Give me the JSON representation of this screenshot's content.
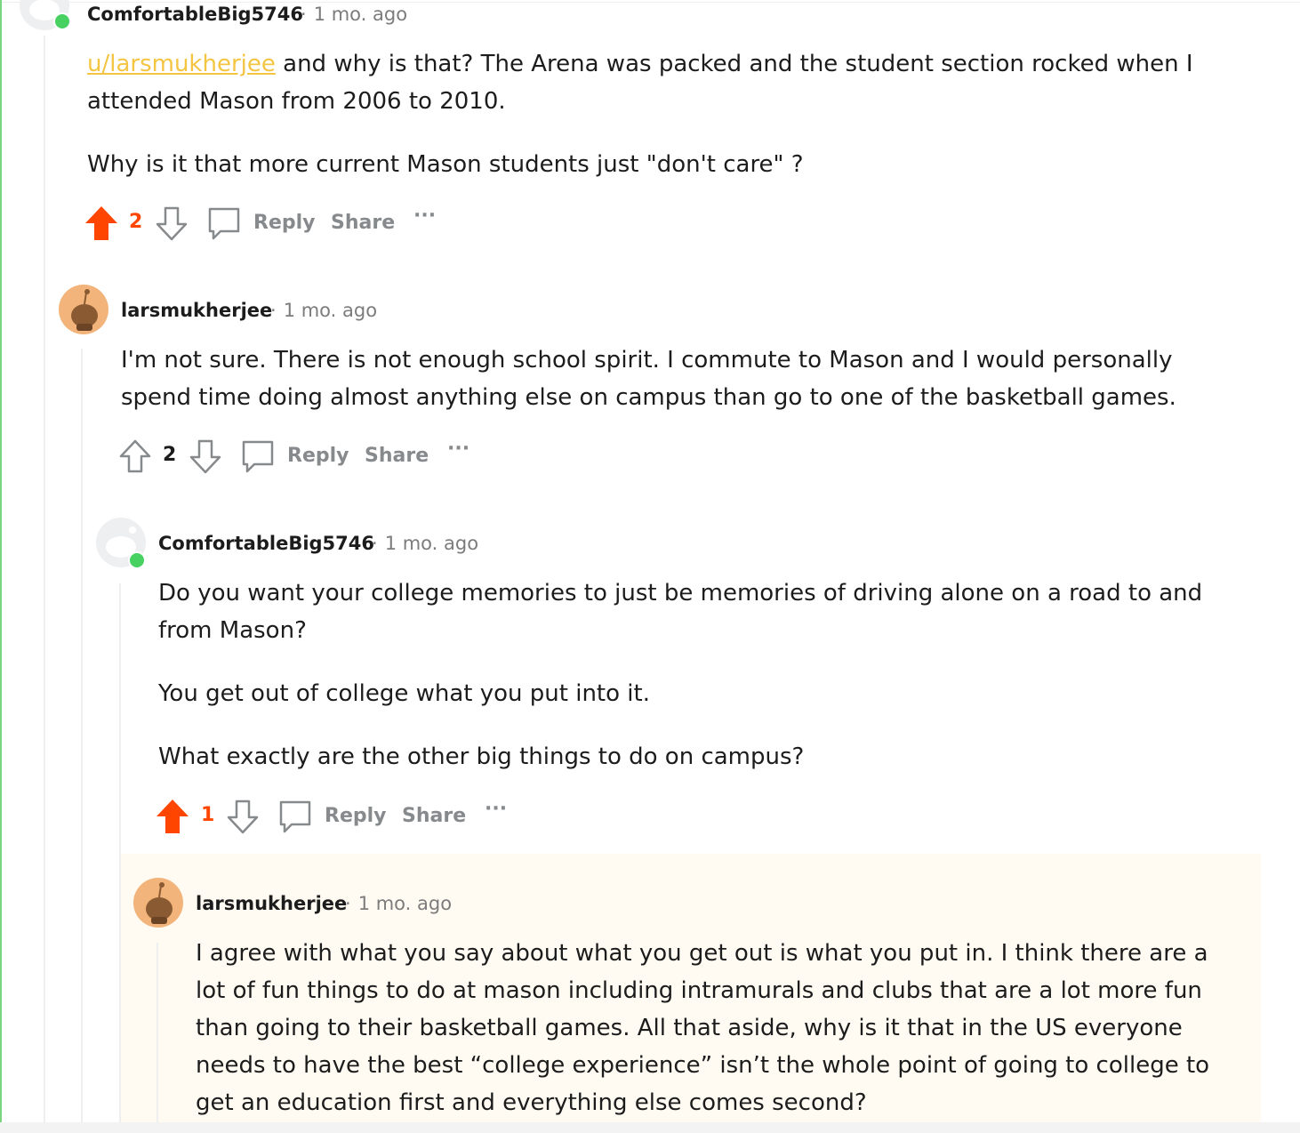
{
  "comments": [
    {
      "username": "ComfortableBig5746",
      "separator": "·",
      "time": "1 mo. ago",
      "mention": "u/larsmukherjee",
      "paragraphs": [
        " and why is that? The Arena was packed and the student section rocked when I attended Mason from 2006 to 2010.",
        "Why is it that more current Mason students just \"don't care\" ?"
      ],
      "score": "2",
      "upvoted": true,
      "actions": {
        "reply": "Reply",
        "share": "Share",
        "more": "···"
      }
    },
    {
      "username": "larsmukherjee",
      "separator": "·",
      "time": "1 mo. ago",
      "paragraphs": [
        "I'm not sure. There is not enough school spirit. I commute to Mason and I would personally spend time doing almost anything else on campus than go to one of the basketball games."
      ],
      "score": "2",
      "upvoted": false,
      "actions": {
        "reply": "Reply",
        "share": "Share",
        "more": "···"
      }
    },
    {
      "username": "ComfortableBig5746",
      "separator": "·",
      "time": "1 mo. ago",
      "paragraphs": [
        "Do you want your college memories to just be memories of driving alone on a road to and from Mason?",
        "You get out of college what you put into it.",
        "What exactly are the other big things to do on campus?"
      ],
      "score": "1",
      "upvoted": true,
      "actions": {
        "reply": "Reply",
        "share": "Share",
        "more": "···"
      }
    },
    {
      "username": "larsmukherjee",
      "separator": "·",
      "time": "1 mo. ago",
      "paragraphs": [
        "I agree with what you say about what you get out is what you put in. I think there are a lot of fun things to do at mason including intramurals and clubs that are a lot more fun than going to their basketball games. All that aside, why is it that in the US everyone needs to have the best “college experience” isn’t the whole point of going to college to get an education first and everything else comes second?"
      ]
    }
  ],
  "colors": {
    "upvote_active": "#ff4500",
    "online": "#46d160",
    "mention": "#f4c542",
    "highlight": "#fffbf2",
    "thread_accent": "#7bd67f"
  },
  "icons": [
    "default-avatar-icon",
    "snoo-avatar-icon",
    "upvote-icon",
    "downvote-icon",
    "comment-bubble-icon",
    "more-options-icon"
  ]
}
